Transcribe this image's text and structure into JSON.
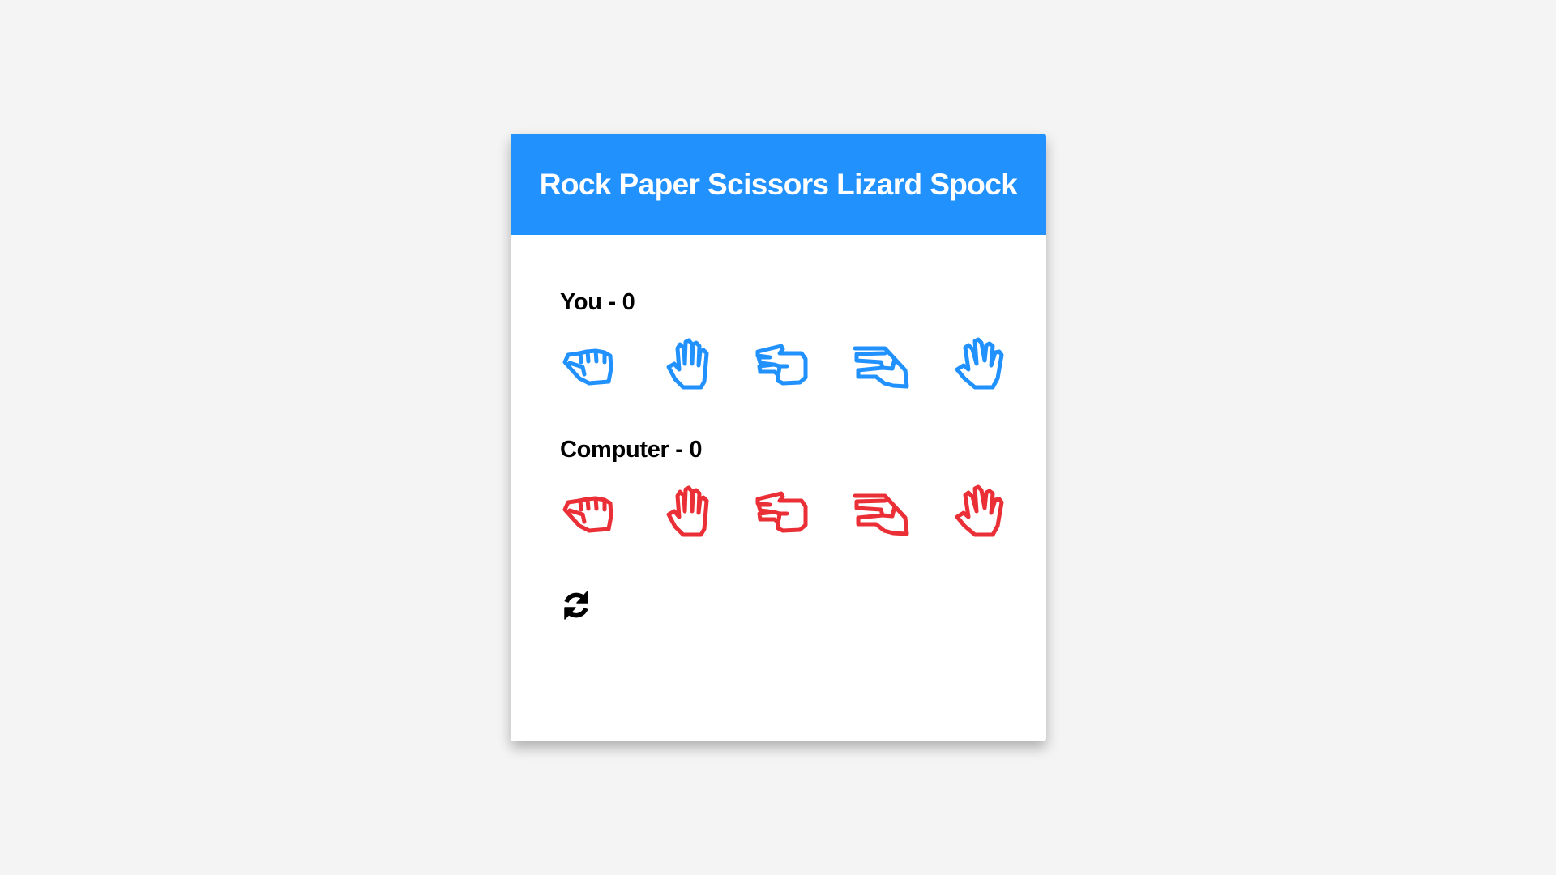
{
  "title": "Rock Paper Scissors Lizard Spock",
  "colors": {
    "header": "#2191fe",
    "player": "#2191fe",
    "computer": "#ea2f36",
    "background": "#f4f4f4"
  },
  "players": [
    {
      "label": "You - 0",
      "color": "player",
      "choices": [
        "rock-icon",
        "paper-icon",
        "scissors-icon",
        "lizard-icon",
        "spock-icon"
      ]
    },
    {
      "label": "Computer - 0",
      "color": "computer",
      "choices": [
        "rock-icon",
        "paper-icon",
        "scissors-icon",
        "lizard-icon",
        "spock-icon"
      ]
    }
  ],
  "reset_icon": "refresh-icon"
}
